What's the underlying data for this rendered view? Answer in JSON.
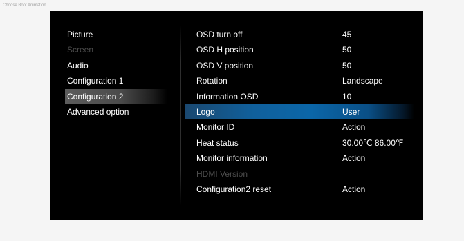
{
  "caption": "Choose Boot Animation",
  "left_menu": [
    {
      "label": "Picture",
      "state": "normal"
    },
    {
      "label": "Screen",
      "state": "disabled"
    },
    {
      "label": "Audio",
      "state": "normal"
    },
    {
      "label": "Configuration 1",
      "state": "normal"
    },
    {
      "label": "Configuration 2",
      "state": "selected"
    },
    {
      "label": "Advanced option",
      "state": "normal"
    }
  ],
  "settings": [
    {
      "label": "OSD turn off",
      "value": "45",
      "state": "normal"
    },
    {
      "label": "OSD H position",
      "value": "50",
      "state": "normal"
    },
    {
      "label": "OSD V position",
      "value": "50",
      "state": "normal"
    },
    {
      "label": "Rotation",
      "value": "Landscape",
      "state": "normal"
    },
    {
      "label": "Information OSD",
      "value": "10",
      "state": "normal"
    },
    {
      "label": "Logo",
      "value": "User",
      "state": "selected"
    },
    {
      "label": "Monitor ID",
      "value": "Action",
      "state": "normal"
    },
    {
      "label": "Heat status",
      "value": "30.00℃ 86.00℉",
      "state": "normal"
    },
    {
      "label": "Monitor information",
      "value": "Action",
      "state": "normal"
    },
    {
      "label": "HDMI Version",
      "value": "",
      "state": "disabled"
    },
    {
      "label": "Configuration2 reset",
      "value": "Action",
      "state": "normal"
    }
  ],
  "colors": {
    "osd_background": "#000000",
    "page_background": "#f5f5f5",
    "highlight_blue": "#0b66a8",
    "highlight_gray": "#5c5c5c",
    "disabled_text": "#4d4d4d"
  }
}
